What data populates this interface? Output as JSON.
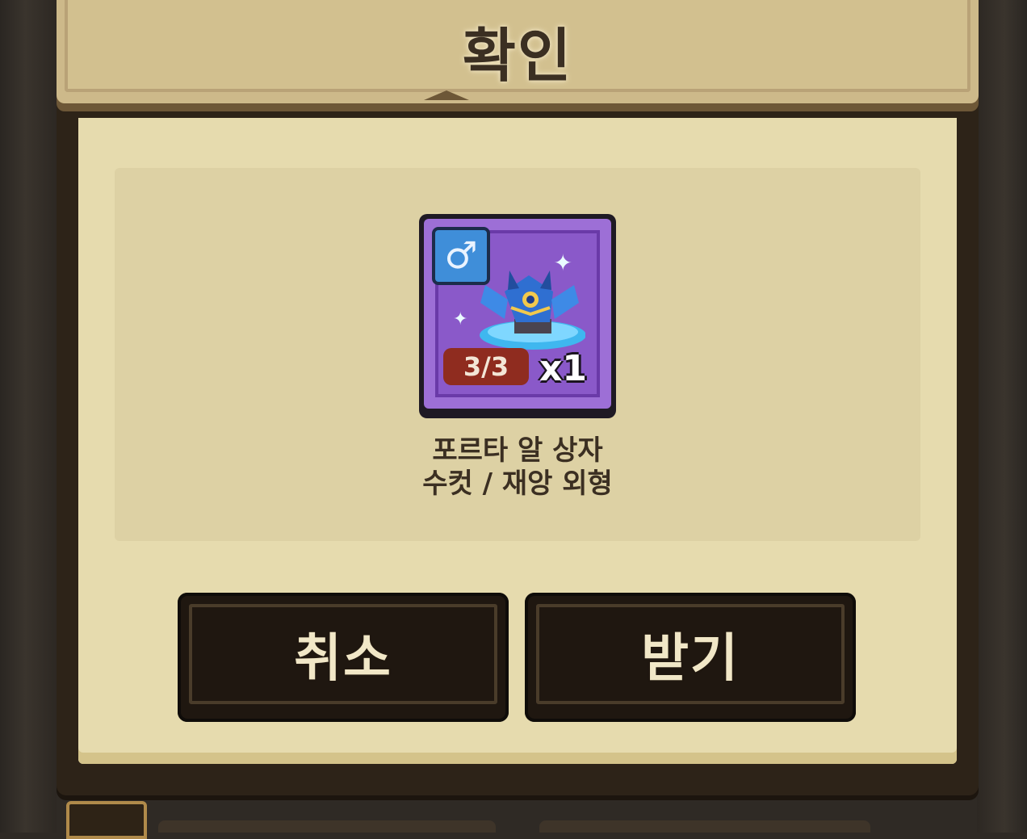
{
  "dialog": {
    "title": "확인",
    "item": {
      "name": "포르타 알 상자",
      "subtitle": "수컷 / 재앙 외형",
      "gender_icon": "male-symbol-icon",
      "gender_symbol": "♂",
      "stock": "3/3",
      "quantity": "x1",
      "card_color": "#9d6fd6"
    },
    "buttons": {
      "cancel": "취소",
      "receive": "받기"
    }
  },
  "colors": {
    "paper": "#e6dbae",
    "title_bar": "#cdb98a",
    "button_bg": "#1f1710",
    "stock_badge": "#8f2c1f"
  }
}
